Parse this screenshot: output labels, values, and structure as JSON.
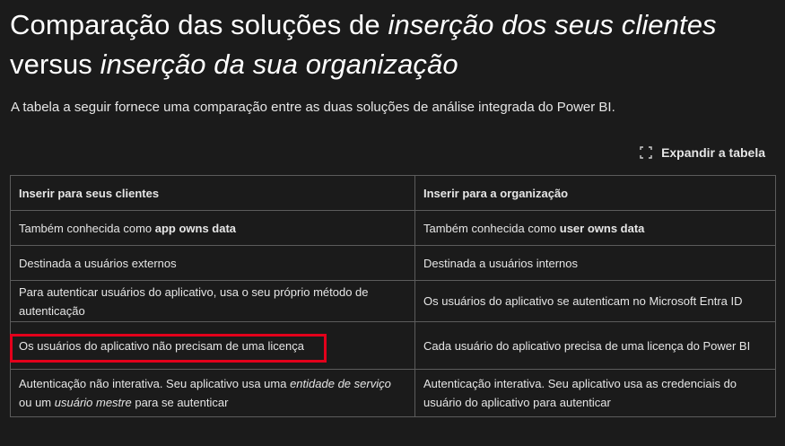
{
  "heading": {
    "part1": "Comparação das soluções de ",
    "part2": "inserção dos seus clientes",
    "part3": " versus ",
    "part4": "inserção da sua organização"
  },
  "intro": "A tabela a seguir fornece uma comparação entre as duas soluções de análise integrada do Power BI.",
  "expand": {
    "label": "Expandir a tabela",
    "icon": "expand-icon"
  },
  "table": {
    "headers": [
      "Inserir para seus clientes",
      "Inserir para a organização"
    ],
    "rows": [
      {
        "c1": {
          "pre": "Também conhecida como ",
          "bold": "app owns data"
        },
        "c2": {
          "pre": "Também conhecida como ",
          "bold": "user owns data"
        }
      },
      {
        "c1": {
          "text": "Destinada a usuários externos"
        },
        "c2": {
          "text": "Destinada a usuários internos"
        }
      },
      {
        "c1": {
          "text": "Para autenticar usuários do aplicativo, usa o seu próprio método de autenticação"
        },
        "c2": {
          "text": "Os usuários do aplicativo se autenticam no Microsoft Entra ID"
        }
      },
      {
        "c1": {
          "text": "Os usuários do aplicativo não precisam de uma licença"
        },
        "c2": {
          "text": "Cada usuário do aplicativo precisa de uma licença do Power BI"
        }
      },
      {
        "c1": {
          "pre": "Autenticação não interativa. Seu aplicativo usa uma ",
          "italic1": "entidade de serviço",
          "mid": " ou um ",
          "italic2": "usuário mestre",
          "post": " para se autenticar"
        },
        "c2": {
          "text": "Autenticação interativa. Seu aplicativo usa as credenciais do usuário do aplicativo para autenticar"
        }
      }
    ]
  },
  "highlight_color": "#e3001b"
}
